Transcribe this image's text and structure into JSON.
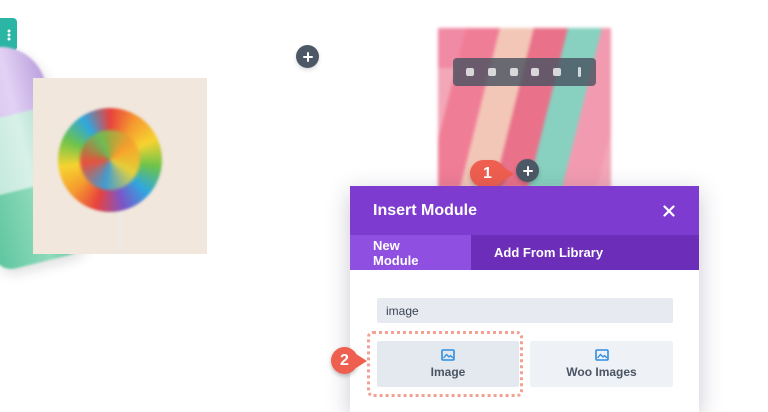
{
  "modal": {
    "title": "Insert Module",
    "tabs": [
      {
        "label": "New Module",
        "active": true
      },
      {
        "label": "Add From Library",
        "active": false
      }
    ],
    "search": {
      "value": "image"
    },
    "modules": [
      {
        "label": "Image",
        "icon": "image-icon",
        "highlighted": true
      },
      {
        "label": "Woo Images",
        "icon": "woo-images-icon",
        "highlighted": false
      }
    ]
  },
  "badges": {
    "step1": "1",
    "step2": "2"
  },
  "colors": {
    "modal_header": "#7d3bcf",
    "modal_tabs": "#6c2eb9",
    "active_tab": "#8f4fe0",
    "badge": "#ef5f4f",
    "teal_tab": "#2bb5a5",
    "dark_button": "#4c5866"
  }
}
